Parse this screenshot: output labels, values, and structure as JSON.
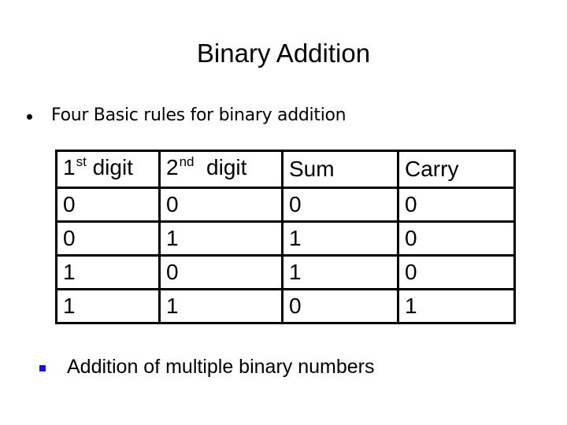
{
  "slide": {
    "title": "Binary Addition",
    "bullets": [
      {
        "icon": "round-bullet-icon",
        "text": "Four Basic rules for binary addition"
      },
      {
        "icon": "square-bullet-icon",
        "text": "Addition of multiple binary numbers",
        "bullet_color": "#1414e6"
      }
    ]
  },
  "table": {
    "headers": [
      {
        "base": "1",
        "sup": "st",
        "rest": " digit"
      },
      {
        "base": "2",
        "sup": "nd",
        "rest": "  digit"
      },
      {
        "base": "Sum",
        "sup": "",
        "rest": ""
      },
      {
        "base": "Carry",
        "sup": "",
        "rest": ""
      }
    ],
    "rows": [
      [
        "0",
        "0",
        "0",
        "0"
      ],
      [
        "0",
        "1",
        "1",
        "0"
      ],
      [
        "1",
        "0",
        "1",
        "0"
      ],
      [
        "1",
        "1",
        "0",
        "1"
      ]
    ]
  }
}
